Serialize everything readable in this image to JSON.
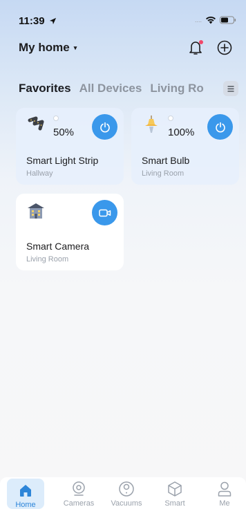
{
  "status_bar": {
    "time": "11:39",
    "signal_dots": "....",
    "location_icon": "location-arrow-icon",
    "wifi_icon": "wifi-icon",
    "battery_icon": "battery-icon"
  },
  "header": {
    "home_name": "My home",
    "caret": "▾",
    "bell_icon": "bell-icon",
    "add_icon": "add-circle-icon",
    "notification_color": "#f1476a"
  },
  "tabs": [
    {
      "label": "Favorites",
      "active": true
    },
    {
      "label": "All Devices",
      "active": false
    },
    {
      "label": "Living Ro",
      "active": false
    }
  ],
  "tabs_menu_icon": "menu-icon",
  "devices": [
    {
      "name": "Smart Light Strip",
      "room": "Hallway",
      "level": "50%",
      "icon": "light-strip-icon",
      "control_icon": "power-icon"
    },
    {
      "name": "Smart Bulb",
      "room": "Living Room",
      "level": "100%",
      "icon": "bulb-icon",
      "control_icon": "power-icon"
    },
    {
      "name": "Smart Camera",
      "room": "Living Room",
      "icon": "camera-house-icon",
      "control_icon": "video-icon"
    }
  ],
  "accent_color": "#3a98eb",
  "bottom_nav": [
    {
      "label": "Home",
      "icon": "home-icon",
      "active": true
    },
    {
      "label": "Cameras",
      "icon": "camera-icon",
      "active": false
    },
    {
      "label": "Vacuums",
      "icon": "vacuum-icon",
      "active": false
    },
    {
      "label": "Smart",
      "icon": "cube-icon",
      "active": false
    },
    {
      "label": "Me",
      "icon": "person-icon",
      "active": false
    }
  ]
}
